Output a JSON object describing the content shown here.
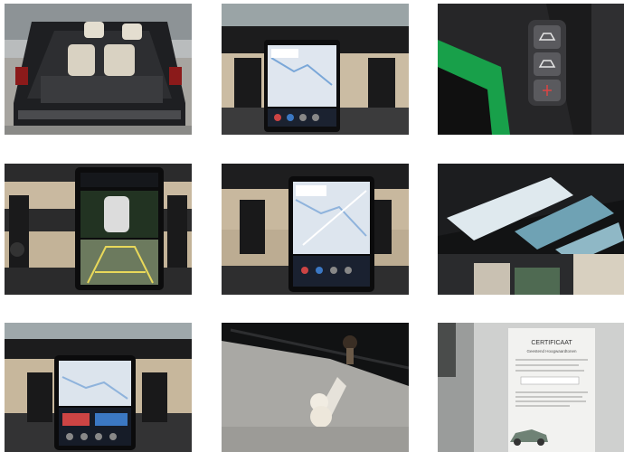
{
  "gallery": {
    "photos": [
      {
        "subject": "open-trunk",
        "icon": "car-trunk-photo"
      },
      {
        "subject": "center-touchscreen-navigation",
        "icon": "dashboard-screen-photo"
      },
      {
        "subject": "trunk-side-control-buttons",
        "icon": "trunk-buttons-photo"
      },
      {
        "subject": "center-touchscreen-parking-camera",
        "icon": "parking-camera-photo"
      },
      {
        "subject": "center-touchscreen-map",
        "icon": "dashboard-map-photo"
      },
      {
        "subject": "panoramic-sunroof",
        "icon": "sunroof-photo"
      },
      {
        "subject": "center-touchscreen-menu",
        "icon": "dashboard-menu-photo"
      },
      {
        "subject": "tow-bar-hitch",
        "icon": "tow-hitch-photo"
      },
      {
        "subject": "certificate-document",
        "icon": "certificate-photo"
      }
    ],
    "certificate": {
      "title": "CERTIFICAAT",
      "subtitle": "Geestend Hoogwaardtonen"
    }
  },
  "colors": {
    "page_background": "#ffffff",
    "dash_dark": "#222222",
    "leather_beige": "#c9b9a0",
    "screen_map": "#dfe6ef"
  }
}
